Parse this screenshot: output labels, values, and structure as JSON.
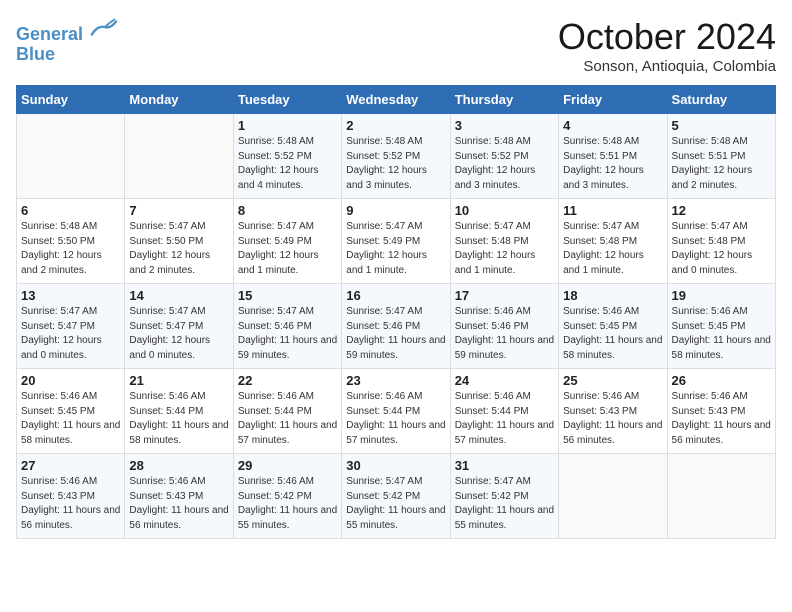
{
  "header": {
    "logo_line1": "General",
    "logo_line2": "Blue",
    "month": "October 2024",
    "location": "Sonson, Antioquia, Colombia"
  },
  "weekdays": [
    "Sunday",
    "Monday",
    "Tuesday",
    "Wednesday",
    "Thursday",
    "Friday",
    "Saturday"
  ],
  "weeks": [
    [
      {
        "day": "",
        "empty": true
      },
      {
        "day": "",
        "empty": true
      },
      {
        "day": "1",
        "sunrise": "5:48 AM",
        "sunset": "5:52 PM",
        "daylight": "12 hours and 4 minutes."
      },
      {
        "day": "2",
        "sunrise": "5:48 AM",
        "sunset": "5:52 PM",
        "daylight": "12 hours and 3 minutes."
      },
      {
        "day": "3",
        "sunrise": "5:48 AM",
        "sunset": "5:52 PM",
        "daylight": "12 hours and 3 minutes."
      },
      {
        "day": "4",
        "sunrise": "5:48 AM",
        "sunset": "5:51 PM",
        "daylight": "12 hours and 3 minutes."
      },
      {
        "day": "5",
        "sunrise": "5:48 AM",
        "sunset": "5:51 PM",
        "daylight": "12 hours and 2 minutes."
      }
    ],
    [
      {
        "day": "6",
        "sunrise": "5:48 AM",
        "sunset": "5:50 PM",
        "daylight": "12 hours and 2 minutes."
      },
      {
        "day": "7",
        "sunrise": "5:47 AM",
        "sunset": "5:50 PM",
        "daylight": "12 hours and 2 minutes."
      },
      {
        "day": "8",
        "sunrise": "5:47 AM",
        "sunset": "5:49 PM",
        "daylight": "12 hours and 1 minute."
      },
      {
        "day": "9",
        "sunrise": "5:47 AM",
        "sunset": "5:49 PM",
        "daylight": "12 hours and 1 minute."
      },
      {
        "day": "10",
        "sunrise": "5:47 AM",
        "sunset": "5:48 PM",
        "daylight": "12 hours and 1 minute."
      },
      {
        "day": "11",
        "sunrise": "5:47 AM",
        "sunset": "5:48 PM",
        "daylight": "12 hours and 1 minute."
      },
      {
        "day": "12",
        "sunrise": "5:47 AM",
        "sunset": "5:48 PM",
        "daylight": "12 hours and 0 minutes."
      }
    ],
    [
      {
        "day": "13",
        "sunrise": "5:47 AM",
        "sunset": "5:47 PM",
        "daylight": "12 hours and 0 minutes."
      },
      {
        "day": "14",
        "sunrise": "5:47 AM",
        "sunset": "5:47 PM",
        "daylight": "12 hours and 0 minutes."
      },
      {
        "day": "15",
        "sunrise": "5:47 AM",
        "sunset": "5:46 PM",
        "daylight": "11 hours and 59 minutes."
      },
      {
        "day": "16",
        "sunrise": "5:47 AM",
        "sunset": "5:46 PM",
        "daylight": "11 hours and 59 minutes."
      },
      {
        "day": "17",
        "sunrise": "5:46 AM",
        "sunset": "5:46 PM",
        "daylight": "11 hours and 59 minutes."
      },
      {
        "day": "18",
        "sunrise": "5:46 AM",
        "sunset": "5:45 PM",
        "daylight": "11 hours and 58 minutes."
      },
      {
        "day": "19",
        "sunrise": "5:46 AM",
        "sunset": "5:45 PM",
        "daylight": "11 hours and 58 minutes."
      }
    ],
    [
      {
        "day": "20",
        "sunrise": "5:46 AM",
        "sunset": "5:45 PM",
        "daylight": "11 hours and 58 minutes."
      },
      {
        "day": "21",
        "sunrise": "5:46 AM",
        "sunset": "5:44 PM",
        "daylight": "11 hours and 58 minutes."
      },
      {
        "day": "22",
        "sunrise": "5:46 AM",
        "sunset": "5:44 PM",
        "daylight": "11 hours and 57 minutes."
      },
      {
        "day": "23",
        "sunrise": "5:46 AM",
        "sunset": "5:44 PM",
        "daylight": "11 hours and 57 minutes."
      },
      {
        "day": "24",
        "sunrise": "5:46 AM",
        "sunset": "5:44 PM",
        "daylight": "11 hours and 57 minutes."
      },
      {
        "day": "25",
        "sunrise": "5:46 AM",
        "sunset": "5:43 PM",
        "daylight": "11 hours and 56 minutes."
      },
      {
        "day": "26",
        "sunrise": "5:46 AM",
        "sunset": "5:43 PM",
        "daylight": "11 hours and 56 minutes."
      }
    ],
    [
      {
        "day": "27",
        "sunrise": "5:46 AM",
        "sunset": "5:43 PM",
        "daylight": "11 hours and 56 minutes."
      },
      {
        "day": "28",
        "sunrise": "5:46 AM",
        "sunset": "5:43 PM",
        "daylight": "11 hours and 56 minutes."
      },
      {
        "day": "29",
        "sunrise": "5:46 AM",
        "sunset": "5:42 PM",
        "daylight": "11 hours and 55 minutes."
      },
      {
        "day": "30",
        "sunrise": "5:47 AM",
        "sunset": "5:42 PM",
        "daylight": "11 hours and 55 minutes."
      },
      {
        "day": "31",
        "sunrise": "5:47 AM",
        "sunset": "5:42 PM",
        "daylight": "11 hours and 55 minutes."
      },
      {
        "day": "",
        "empty": true
      },
      {
        "day": "",
        "empty": true
      }
    ]
  ]
}
